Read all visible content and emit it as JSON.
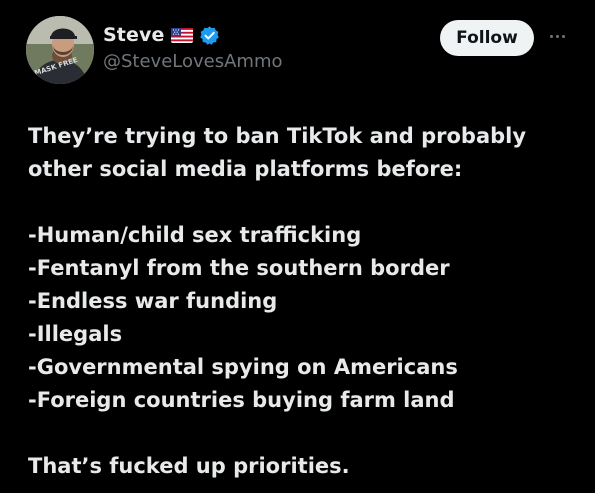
{
  "tweet": {
    "author": {
      "display_name": "Steve",
      "flag_icon": "us-flag-icon",
      "verified_icon": "verified-badge-icon",
      "handle": "@SteveLovesAmmo",
      "avatar_shirt_text": "MASK FREE"
    },
    "follow_label": "Follow",
    "more_icon": "more-options-icon",
    "body": {
      "intro_line_1": "They’re trying to ban TikTok and probably",
      "intro_line_2": "other social media platforms before:",
      "list": [
        "-Human/child sex trafficking",
        "-Fentanyl from the southern border",
        "-Endless war funding",
        "-Illegals",
        "-Governmental spying on Americans",
        "-Foreign countries buying farm land"
      ],
      "closing": "That’s fucked up priorities."
    }
  },
  "colors": {
    "background": "#000000",
    "text_primary": "#e7e9ea",
    "text_secondary": "#71767b",
    "verified_blue": "#1d9bf0",
    "follow_bg": "#eff3f4"
  }
}
